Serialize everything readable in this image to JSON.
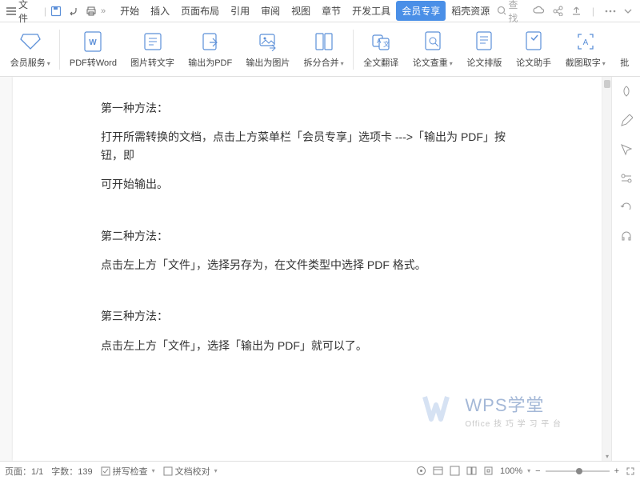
{
  "topbar": {
    "file": "文件",
    "chevron": "»"
  },
  "tabs": [
    "开始",
    "插入",
    "页面布局",
    "引用",
    "审阅",
    "视图",
    "章节",
    "开发工具",
    "会员专享",
    "稻壳资源"
  ],
  "activeTab": 8,
  "search": "查找",
  "ribbon": [
    {
      "label": "会员服务",
      "dd": true
    },
    {
      "label": "PDF转Word"
    },
    {
      "label": "图片转文字"
    },
    {
      "label": "输出为PDF"
    },
    {
      "label": "输出为图片"
    },
    {
      "label": "拆分合并",
      "dd": true
    },
    {
      "label": "全文翻译"
    },
    {
      "label": "论文查重",
      "dd": true
    },
    {
      "label": "论文排版"
    },
    {
      "label": "论文助手"
    },
    {
      "label": "截图取字",
      "dd": true
    },
    {
      "label": "批"
    }
  ],
  "doc": {
    "m1": "第一种方法：",
    "m1b": "打开所需转换的文档，点击上方菜单栏「会员专享」选项卡  --->「输出为 PDF」按钮，即",
    "m1c": "可开始输出。",
    "m2": "第二种方法：",
    "m2b": "点击左上方「文件」，选择另存为，在文件类型中选择 PDF 格式。",
    "m3": "第三种方法：",
    "m3b": "点击左上方「文件」，选择「输出为 PDF」就可以了。"
  },
  "wm": {
    "t1": "WPS学堂",
    "t2": "Office 技 巧 学 习 平 台"
  },
  "status": {
    "page": "页面：1/1",
    "words": "字数：139",
    "spell": "拼写检查",
    "proof": "文档校对",
    "zoom": "100%"
  }
}
